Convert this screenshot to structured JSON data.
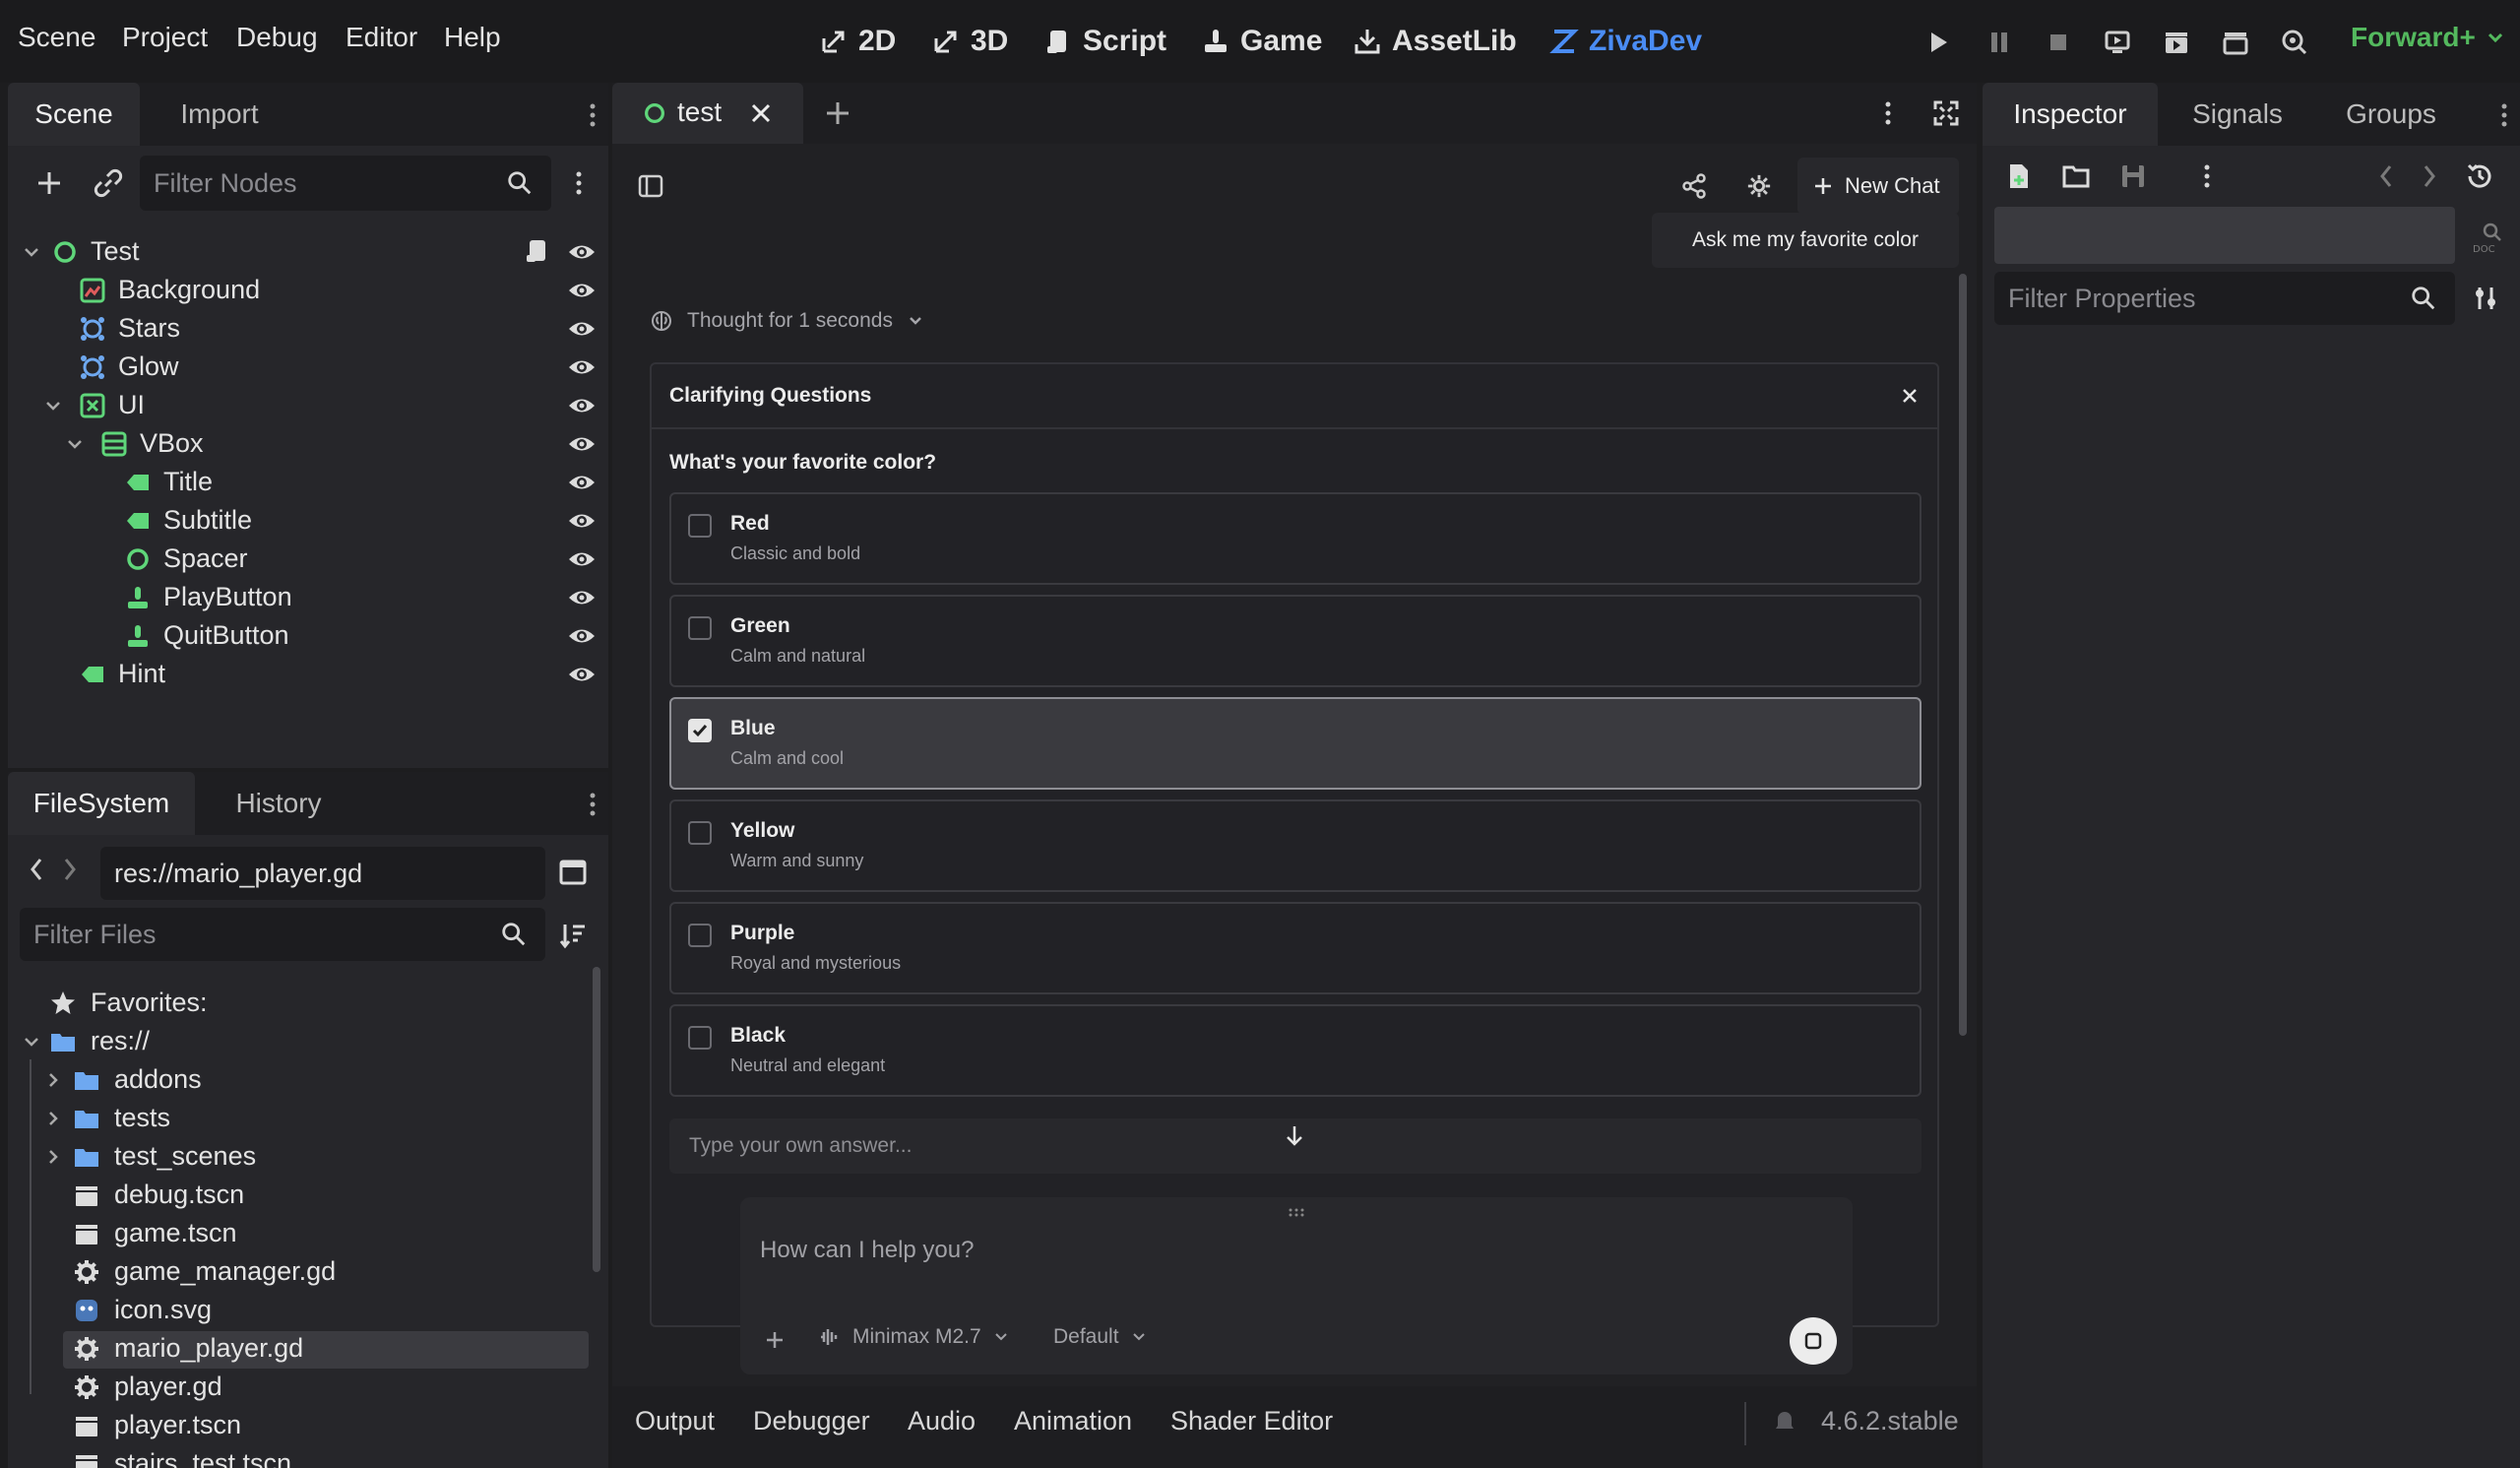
{
  "menu": [
    "Scene",
    "Project",
    "Debug",
    "Editor",
    "Help"
  ],
  "workspaces": [
    {
      "label": "2D",
      "icon": "2d-icon"
    },
    {
      "label": "3D",
      "icon": "3d-icon"
    },
    {
      "label": "Script",
      "icon": "script-icon"
    },
    {
      "label": "Game",
      "icon": "game-icon"
    },
    {
      "label": "AssetLib",
      "icon": "assetlib-icon"
    },
    {
      "label": "ZivaDev",
      "icon": "zivadev-icon",
      "active": true
    }
  ],
  "renderer": "Forward+",
  "scene_dock": {
    "tabs": [
      "Scene",
      "Import"
    ],
    "filter_placeholder": "Filter Nodes",
    "nodes": [
      {
        "name": "Test",
        "icon": "node-icon"
      },
      {
        "name": "Background",
        "icon": "texture-rect-icon"
      },
      {
        "name": "Stars",
        "icon": "particles-icon"
      },
      {
        "name": "Glow",
        "icon": "particles-icon"
      },
      {
        "name": "UI",
        "icon": "control-icon"
      },
      {
        "name": "VBox",
        "icon": "vbox-icon"
      },
      {
        "name": "Title",
        "icon": "label-icon"
      },
      {
        "name": "Subtitle",
        "icon": "label-icon"
      },
      {
        "name": "Spacer",
        "icon": "control-circle-icon"
      },
      {
        "name": "PlayButton",
        "icon": "button-icon"
      },
      {
        "name": "QuitButton",
        "icon": "button-icon"
      },
      {
        "name": "Hint",
        "icon": "label-icon"
      }
    ]
  },
  "filesystem_dock": {
    "tabs": [
      "FileSystem",
      "History"
    ],
    "path": "res://mario_player.gd",
    "filter_placeholder": "Filter Files",
    "items": [
      {
        "name": "Favorites:",
        "icon": "star-icon"
      },
      {
        "name": "res://",
        "icon": "folder-icon"
      },
      {
        "name": "addons",
        "icon": "folder-icon"
      },
      {
        "name": "tests",
        "icon": "folder-icon"
      },
      {
        "name": "test_scenes",
        "icon": "folder-icon"
      },
      {
        "name": "debug.tscn",
        "icon": "scene-file-icon"
      },
      {
        "name": "game.tscn",
        "icon": "scene-file-icon"
      },
      {
        "name": "game_manager.gd",
        "icon": "gear-icon"
      },
      {
        "name": "icon.svg",
        "icon": "image-file-icon"
      },
      {
        "name": "mario_player.gd",
        "icon": "gear-icon",
        "selected": true
      },
      {
        "name": "player.gd",
        "icon": "gear-icon"
      },
      {
        "name": "player.tscn",
        "icon": "scene-file-icon"
      },
      {
        "name": "stairs_test.tscn",
        "icon": "scene-file-icon"
      }
    ]
  },
  "editor_tab": {
    "label": "test"
  },
  "chat": {
    "new_chat_label": "New Chat",
    "user_message": "Ask me my favorite color",
    "thought_label": "Thought for 1 seconds",
    "clarifying": {
      "title": "Clarifying Questions",
      "question": "What's your favorite color?",
      "options": [
        {
          "title": "Red",
          "desc": "Classic and bold",
          "checked": false
        },
        {
          "title": "Green",
          "desc": "Calm and natural",
          "checked": false
        },
        {
          "title": "Blue",
          "desc": "Calm and cool",
          "checked": true
        },
        {
          "title": "Yellow",
          "desc": "Warm and sunny",
          "checked": false
        },
        {
          "title": "Purple",
          "desc": "Royal and mysterious",
          "checked": false
        },
        {
          "title": "Black",
          "desc": "Neutral and elegant",
          "checked": false
        }
      ],
      "own_answer_placeholder": "Type your own answer..."
    },
    "input_placeholder": "How can I help you?",
    "model": "Minimax M2.7",
    "mode": "Default"
  },
  "bottom_panel": {
    "tabs": [
      "Output",
      "Debugger",
      "Audio",
      "Animation",
      "Shader Editor"
    ],
    "version": "4.6.2.stable"
  },
  "inspector": {
    "tabs": [
      "Inspector",
      "Signals",
      "Groups"
    ],
    "filter_placeholder": "Filter Properties"
  },
  "colors": {
    "accent_blue": "#4a8cf4",
    "node_green": "#5fd67a",
    "renderer_green": "#54b95e",
    "folder_blue": "#6ea8f0"
  }
}
